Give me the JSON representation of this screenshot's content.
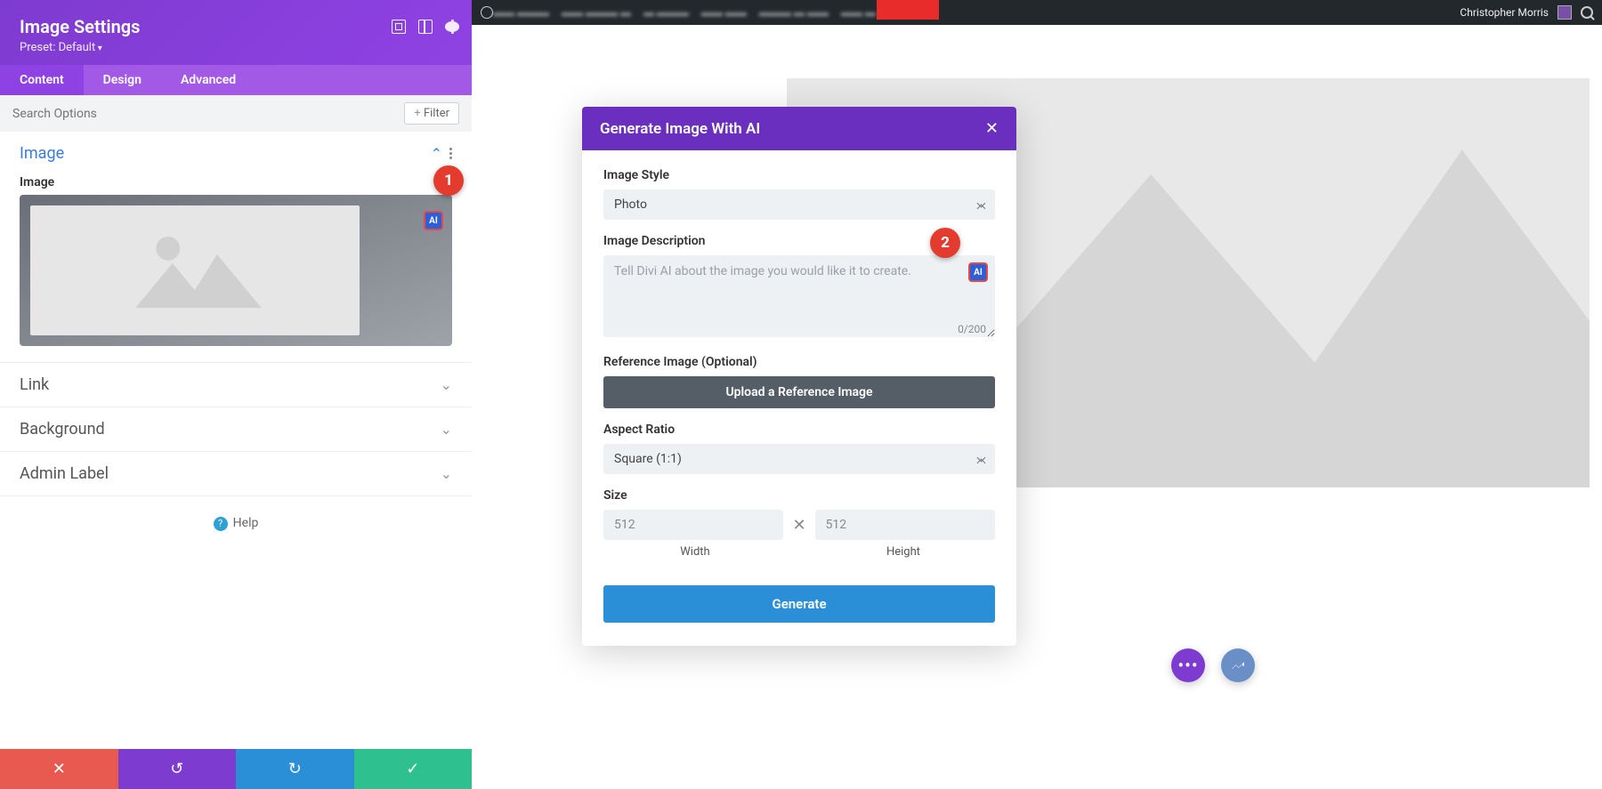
{
  "panel": {
    "title": "Image Settings",
    "preset": "Preset: Default",
    "tabs": [
      "Content",
      "Design",
      "Advanced"
    ],
    "active_tab": 0,
    "search_placeholder": "Search Options",
    "filter": "Filter",
    "sections": {
      "image": {
        "title": "Image",
        "field_label": "Image"
      },
      "link": {
        "title": "Link"
      },
      "background": {
        "title": "Background"
      },
      "admin_label": {
        "title": "Admin Label"
      }
    },
    "help": "Help"
  },
  "bottom_bar": {
    "close": "✕",
    "undo": "↺",
    "redo": "↻",
    "save": "✓"
  },
  "wp_bar": {
    "user": "Christopher Morris"
  },
  "modal": {
    "title": "Generate Image With AI",
    "close": "✕",
    "style_label": "Image Style",
    "style_value": "Photo",
    "desc_label": "Image Description",
    "desc_placeholder": "Tell Divi AI about the image you would like it to create.",
    "desc_count": "0/200",
    "ref_label": "Reference Image (Optional)",
    "upload": "Upload a Reference Image",
    "aspect_label": "Aspect Ratio",
    "aspect_value": "Square (1:1)",
    "size_label": "Size",
    "width_value": "512",
    "height_value": "512",
    "width_label": "Width",
    "height_label": "Height",
    "generate": "Generate"
  },
  "annotations": {
    "a1": "1",
    "a2": "2"
  },
  "ai_chip": "AI",
  "fab": {
    "more_label": "•••"
  }
}
